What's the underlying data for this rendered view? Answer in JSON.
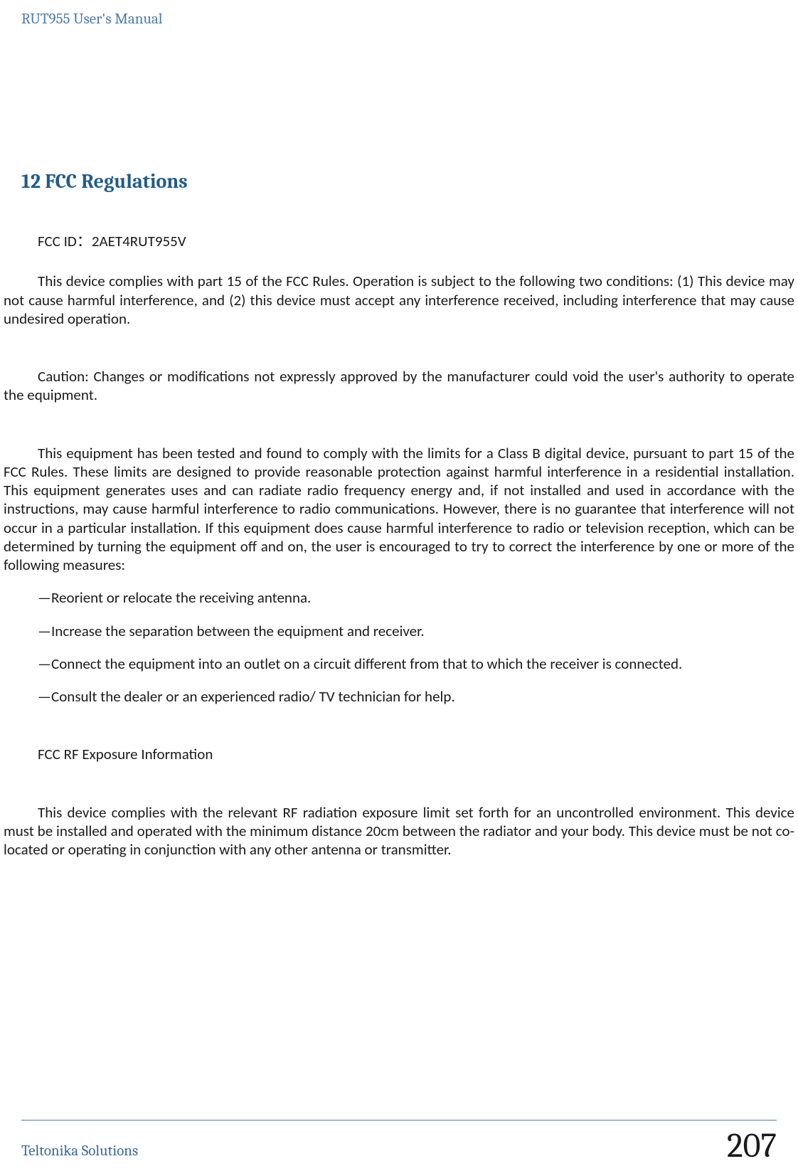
{
  "header": {
    "title": "RUT955 User's Manual"
  },
  "section": {
    "number": "12",
    "title": "FCC Regulations"
  },
  "body": {
    "fcc_id": "FCC ID：2AET4RUT955V",
    "compliance": "This device complies with part 15 of the FCC Rules. Operation is subject to the following two conditions: (1) This device may not cause harmful interference, and (2) this device must accept any interference received, including interference that may cause undesired operation.",
    "caution": "Caution: Changes or modifications not expressly approved by the manufacturer could void the user's authority to operate the equipment.",
    "equipment": "This equipment has been tested and found to comply with the limits for a Class B digital device, pursuant to part 15 of the FCC Rules. These limits are designed to provide reasonable protection against harmful interference in a residential installation. This equipment generates uses and can radiate radio frequency energy and, if not installed and used in accordance with the instructions, may cause harmful interference to radio communications. However, there is no guarantee that interference will not occur in a particular installation. If this equipment does cause harmful interference to radio or television reception, which can be determined by turning the equipment off and on, the user is encouraged to try to correct the interference by one or more of the following measures:",
    "measure1": "—Reorient or relocate the receiving antenna.",
    "measure2": "—Increase the separation between the equipment and receiver.",
    "measure3": "—Connect the equipment into an outlet on a circuit different from that to which the receiver is connected.",
    "measure4": "—Consult the dealer or an experienced radio/ TV technician for help.",
    "rf_heading": "FCC RF Exposure Information",
    "rf_body": "This device complies with the relevant RF radiation exposure limit set forth for an uncontrolled environment. This device must be installed and operated with the minimum distance 20cm between the radiator and your body. This device must be not co-located or operating in conjunction with any other antenna or transmitter."
  },
  "footer": {
    "company": "Teltonika Solutions",
    "page": "207"
  }
}
